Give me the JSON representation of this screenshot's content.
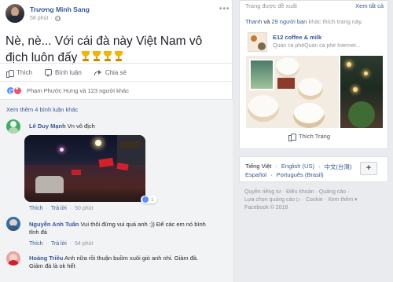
{
  "post": {
    "author": "Trương Minh Sang",
    "time": "58 phút",
    "text": "Nè, nè... Với cái đà này Việt Nam vô địch luôn đấy",
    "trophy_count": 4,
    "actions": {
      "like": "Thích",
      "comment": "Bình luận",
      "share": "Chia sẻ"
    },
    "reactions_text": "Phạm Phước Hưng và 123 người khác",
    "more_comments": "Xem thêm 4 bình luận khác",
    "menu_icon": "more-dots-icon"
  },
  "comments": [
    {
      "name": "Lê Duy Mạnh",
      "text": "Vn vô địch",
      "has_photo": true,
      "reaction_count": "1",
      "meta": {
        "like": "Thích",
        "reply": "Trả lời",
        "time": "50 phút"
      }
    },
    {
      "name": "Nguyễn Anh Tuấn",
      "text_line1": "Vui thôi đừng vui quá anh :)) Để các em nó bình",
      "text_line2": "tĩnh đá",
      "meta": {
        "like": "Thích",
        "reply": "Trả lời",
        "time": "54 phút"
      }
    },
    {
      "name": "Hoàng Triều",
      "text_line1": "Anh nữa rồi thuận buồm xuôi gió anh nhỉ. Giảm đà.",
      "text_line2": "Giảm đà là ok hết"
    }
  ],
  "sidebar": {
    "suggest_title": "Trang được đề xuất",
    "see_all": "Xem tất cả",
    "friends_like_name": "Thanh",
    "friends_like_mid": " và ",
    "friends_like_count": "29 người bạn",
    "friends_like_tail": " khác thích trang này.",
    "page_name": "E12 coffee & milk",
    "page_desc": "Quán cà phêQuán cà phê Internet...",
    "like_page": "Thích Trang",
    "languages": {
      "current": "Tiếng Việt",
      "options_row1": [
        "English (US)",
        "中文(台灣)"
      ],
      "options_row2": [
        "Español",
        "Português (Brasil)"
      ],
      "add": "+"
    },
    "footer": {
      "row1": [
        "Quyền riêng tư",
        "·",
        "Điều khoản",
        "·",
        "Quảng cáo",
        "·"
      ],
      "row2": [
        "Lựa chọn quảng cáo",
        "▷",
        "·",
        "Cookie",
        "·",
        "Xem thêm",
        "▾"
      ],
      "row3": [
        "Facebook © 2018"
      ]
    }
  }
}
